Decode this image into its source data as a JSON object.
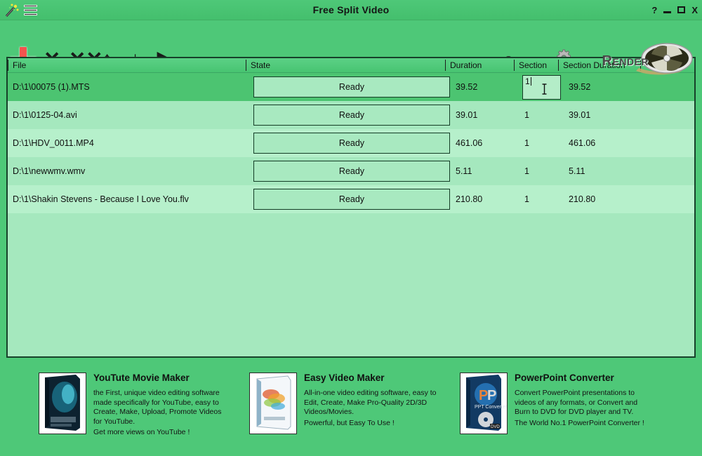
{
  "window": {
    "title": "Free Split Video",
    "app_icon": "magic-wand-icon",
    "menu_icon": "hamburger-menu-icon",
    "controls": {
      "help": "?",
      "minimize": "minimize-icon",
      "maximize": "maximize-icon",
      "close": "X"
    }
  },
  "toolbar": {
    "add": "+",
    "add_name": "add-file-icon",
    "remove": "✕",
    "remove_all": "✕✕",
    "move_up": "↑",
    "move_down": "↓",
    "play": "▶",
    "settings_label": "Settings",
    "render_label": "Render"
  },
  "table": {
    "columns": [
      "File",
      "State",
      "Duration",
      "Section",
      "Section Duration",
      ""
    ],
    "rows": [
      {
        "file": "D:\\1\\00075 (1).MTS",
        "state": "Ready",
        "duration": "39.52",
        "section": "1",
        "section_duration": "39.52",
        "selected": true,
        "editing": true
      },
      {
        "file": "D:\\1\\0125-04.avi",
        "state": "Ready",
        "duration": "39.01",
        "section": "1",
        "section_duration": "39.01",
        "selected": false,
        "editing": false
      },
      {
        "file": "D:\\1\\HDV_0011.MP4",
        "state": "Ready",
        "duration": "461.06",
        "section": "1",
        "section_duration": "461.06",
        "selected": false,
        "editing": false
      },
      {
        "file": "D:\\1\\newwmv.wmv",
        "state": "Ready",
        "duration": "5.11",
        "section": "1",
        "section_duration": "5.11",
        "selected": false,
        "editing": false
      },
      {
        "file": "D:\\1\\Shakin Stevens - Because I Love You.flv",
        "state": "Ready",
        "duration": "210.80",
        "section": "1",
        "section_duration": "210.80",
        "selected": false,
        "editing": false
      }
    ]
  },
  "footer": {
    "ads": [
      {
        "title": "YouTute Movie Maker",
        "desc": "the First, unique video editing software\nmade specifically for YouTube, easy to\nCreate, Make, Upload, Promote Videos\nfor YouTube.",
        "tagline": "Get more views on YouTube !",
        "box_icon": "youtube-movie-maker-box-icon"
      },
      {
        "title": "Easy Video Maker",
        "desc": "All-in-one video editing software, easy to\nEdit, Create, Make Pro-Quality 2D/3D\nVideos/Movies.",
        "tagline": "Powerful, but Easy To Use !",
        "box_icon": "easy-video-maker-box-icon"
      },
      {
        "title": "PowerPoint Converter",
        "desc": "Convert PowerPoint presentations to\nvideos of any formats, or Convert and\nBurn to DVD for DVD player and TV.",
        "tagline": "The World No.1 PowerPoint Converter !",
        "box_icon": "powerpoint-converter-box-icon"
      }
    ]
  },
  "colors": {
    "accent_green": "#4ec878",
    "header_green": "#50cb7c",
    "row_light": "#a5e8be",
    "row_lighter": "#b6f0cb",
    "selected_row": "#4cc471",
    "add_red": "#f4544e",
    "border_dark": "#17412a"
  }
}
